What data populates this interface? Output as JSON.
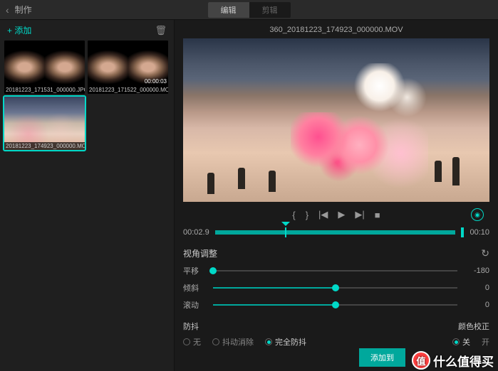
{
  "header": {
    "title": "制作"
  },
  "tabs": {
    "edit": "编辑",
    "other": "剪辑"
  },
  "sidebar": {
    "add_label": "添加",
    "thumbs": [
      {
        "label": "20181223_171531_000000.JPG",
        "time": ""
      },
      {
        "label": "20181223_171522_000000.MOV",
        "time": "00:00:03"
      },
      {
        "label": "20181223_174923_000000.MOV",
        "time": ""
      }
    ]
  },
  "preview": {
    "filename": "360_20181223_174923_000000.MOV"
  },
  "timeline": {
    "current": "00:02.9",
    "total": "00:10"
  },
  "adjust": {
    "title": "视角调整",
    "sliders": [
      {
        "label": "平移",
        "value": "-180"
      },
      {
        "label": "倾斜",
        "value": "0"
      },
      {
        "label": "滚动",
        "value": "0"
      }
    ]
  },
  "stabilize": {
    "title": "防抖",
    "options": {
      "none": "无",
      "remove": "抖动消除",
      "full": "完全防抖"
    }
  },
  "color": {
    "title": "颜色校正",
    "off": "关",
    "on": "开"
  },
  "actions": {
    "add_to": "添加到"
  },
  "watermark": {
    "badge": "值",
    "text": "什么值得买"
  }
}
